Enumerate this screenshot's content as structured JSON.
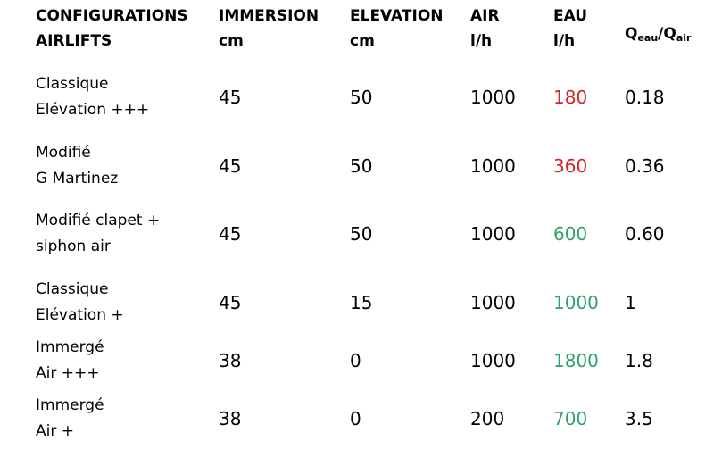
{
  "header": {
    "col1": [
      "CONFIGURATIONS",
      "AIRLIFTS"
    ],
    "col2": [
      "IMMERSION",
      "cm"
    ],
    "col3": [
      "ELEVATION",
      "cm"
    ],
    "col4": [
      "AIR",
      "l/h"
    ],
    "col5": [
      "EAU",
      "l/h"
    ],
    "col6": {
      "q1": "Q",
      "sub1": "eau",
      "slash": "/",
      "q2": "Q",
      "sub2": "air"
    }
  },
  "colors": {
    "low": "#d9222a",
    "high": "#2ea36a"
  },
  "rows": [
    {
      "config": [
        "Classique",
        "Elévation +++"
      ],
      "immersion": "45",
      "elevation": "50",
      "air": "1000",
      "eau": "180",
      "eau_status": "low",
      "ratio": "0.18"
    },
    {
      "config": [
        "Modifié",
        "G Martinez"
      ],
      "immersion": "45",
      "elevation": "50",
      "air": "1000",
      "eau": "360",
      "eau_status": "low",
      "ratio": "0.36"
    },
    {
      "config": [
        "Modifié clapet +",
        "siphon air"
      ],
      "immersion": "45",
      "elevation": "50",
      "air": "1000",
      "eau": "600",
      "eau_status": "high",
      "ratio": "0.60"
    },
    {
      "config": [
        "Classique",
        "Elévation +"
      ],
      "immersion": "45",
      "elevation": "15",
      "air": "1000",
      "eau": "1000",
      "eau_status": "high",
      "ratio": "1"
    },
    {
      "config": [
        "Immergé",
        "Air +++"
      ],
      "immersion": "38",
      "elevation": "0",
      "air": "1000",
      "eau": "1800",
      "eau_status": "high",
      "ratio": "1.8"
    },
    {
      "config": [
        "Immergé",
        "Air +"
      ],
      "immersion": "38",
      "elevation": "0",
      "air": "200",
      "eau": "700",
      "eau_status": "high",
      "ratio": "3.5"
    }
  ]
}
